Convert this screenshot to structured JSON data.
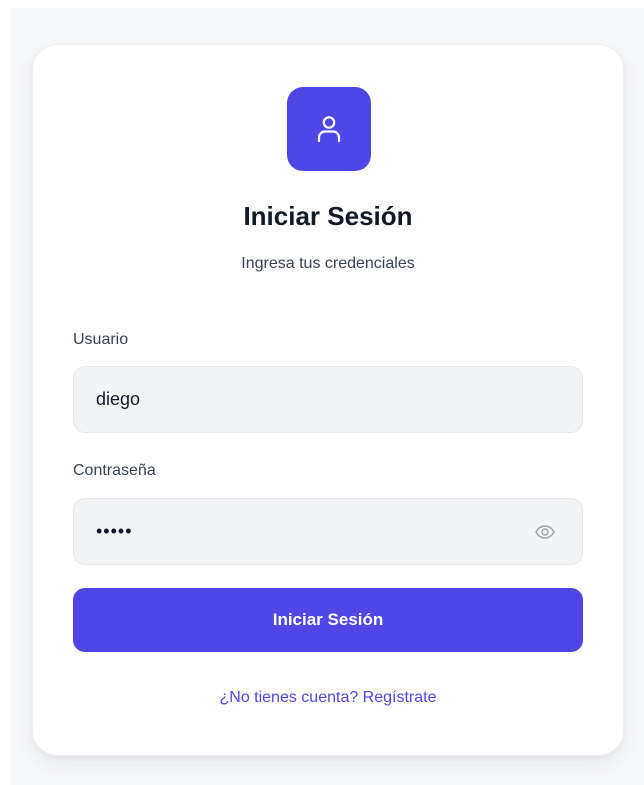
{
  "login": {
    "title": "Iniciar Sesión",
    "subtitle": "Ingresa tus credenciales",
    "username_label": "Usuario",
    "username_value": "diego",
    "password_label": "Contraseña",
    "password_value": "•••••",
    "submit_label": "Iniciar Sesión",
    "register_link": "¿No tienes cuenta? Regístrate"
  },
  "icons": {
    "logo": "user-icon",
    "password_toggle": "eye-icon"
  },
  "colors": {
    "accent": "#4f46e5",
    "page_background": "#f8f9fb",
    "card_background": "#ffffff",
    "input_background": "#f3f4f6",
    "text_primary": "#111827",
    "text_secondary": "#374151"
  }
}
